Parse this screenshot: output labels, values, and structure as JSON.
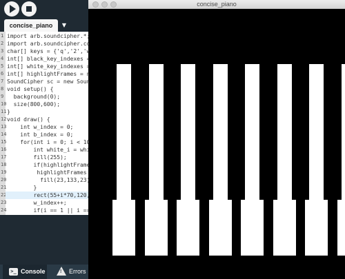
{
  "ide": {
    "toolbar": {
      "run_icon": "play-icon",
      "stop_icon": "stop-icon"
    },
    "tab": {
      "label": "concise_piano",
      "menu_glyph": "▼"
    },
    "gutter_numbers": [
      "1",
      "2",
      "3",
      "4",
      "5",
      "6",
      "7",
      "8",
      "9",
      "10",
      "11",
      "12",
      "13",
      "14",
      "15",
      "16",
      "17",
      "18",
      "19",
      "20",
      "21",
      "22",
      "23",
      "24"
    ],
    "code_lines": [
      "import arb.soundcipher.*;",
      "import arb.soundcipher.con",
      "char[] keys = {'q','2','w",
      "int[] black_key_indexes =",
      "int[] white_key_indexes =",
      "int[] highlightFrames = ne",
      "SoundCipher sc = new Sound",
      "void setup() {",
      "  background(0);",
      "  size(800,600);",
      "}",
      "void draw() {",
      "    int w_index = 0;",
      "    int b_index = 0;",
      "    for(int i = 0; i < 10",
      "        int white_i = whi",
      "        fill(255);",
      "        if(highlightFrame",
      "         highlightFrames",
      "          fill(23,133,23)",
      "        }",
      "        rect(55+i*70,120,0",
      "        w_index++;",
      "        if(i == 1 || i ==",
      "         int black_i =  b"
    ],
    "highlighted_line_index": 21,
    "status": {
      "console_label": "Console",
      "errors_label": "Errors"
    }
  },
  "sketch": {
    "window_title": "concise_piano",
    "background_color": "#000000",
    "white_key_color": "#ffffff",
    "white_keys_visible": 8
  }
}
